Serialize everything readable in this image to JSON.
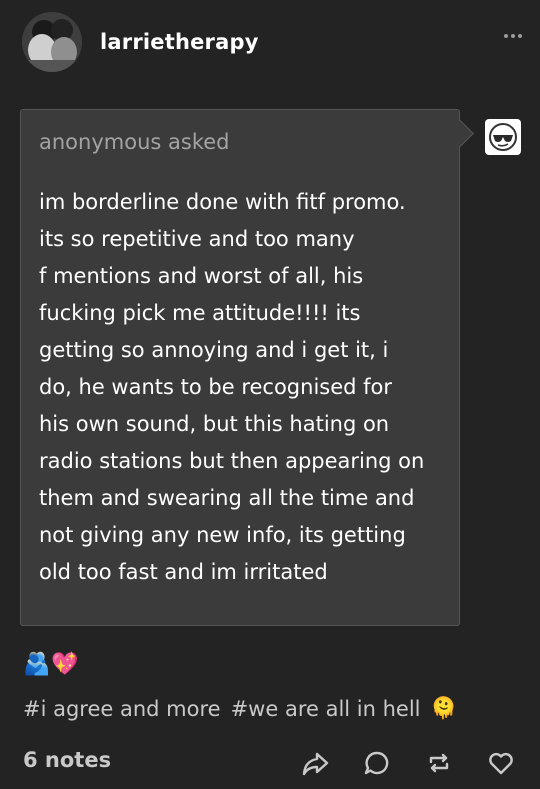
{
  "post": {
    "blog_name": "larrietherapy",
    "avatar_icon": "blog-avatar",
    "more_icon": "more-options-icon"
  },
  "ask": {
    "asker": "anonymous",
    "asked_label": "asked",
    "question": "im borderline done with fitf promo.\nits so repetitive and too many\nf mentions and worst of all, his\nfucking pick me attitude!!!! its\ngetting so annoying and i get it, i\ndo, he wants to be recognised for\nhis own sound, but this hating on\nradio stations but then appearing on\nthem and swearing all the time and\nnot giving any new info, its getting\nold too fast and im irritated",
    "asker_avatar_icon": "anonymous-sunglasses-avatar"
  },
  "body": {
    "emojis": [
      "🫂",
      "💖"
    ]
  },
  "tags": [
    "#i agree and more",
    "#we are all in hell"
  ],
  "tag_emoji": "🫠",
  "footer": {
    "notes_label": "6 notes",
    "icons": [
      "share-icon",
      "reply-icon",
      "reblog-icon",
      "like-icon"
    ]
  },
  "colors": {
    "background": "#232323",
    "ask_box": "#3b3b3b",
    "muted_text": "#a3a3a3",
    "icon": "#c9c9c9"
  }
}
